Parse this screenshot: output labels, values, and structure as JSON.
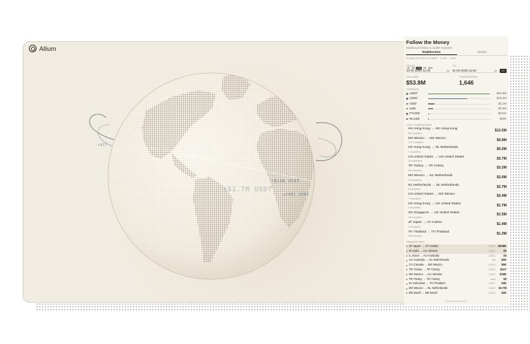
{
  "app": {
    "brand": "Allium"
  },
  "globe_labels": [
    {
      "text": "+$1T",
      "color": "#9aa3ad"
    },
    {
      "text": "+$1.7M USDT",
      "color": "#a9b1b9"
    },
    {
      "text": "+$16K USDT",
      "color": "#8f99a3"
    },
    {
      "text": "+$412 USDC",
      "color": "#8f99a3"
    }
  ],
  "panel": {
    "title": "Follow the Money",
    "subtitle": "Stablecoin flows & wallet explorer",
    "tabs": [
      {
        "label": "Stablecoins",
        "active": true
      },
      {
        "label": "Wallet",
        "active": false
      }
    ],
    "section_flows": "STABLECOIN FLOWS · LIVE · 24H",
    "ranges": [
      "1h",
      "4h",
      "24h",
      "7d",
      "30d"
    ],
    "range_selected": "24h",
    "from_label": "FROM",
    "to_label": "TO",
    "from_value": "10-02-2020 11:00",
    "to_value": "11-02-2025 11:00",
    "go_label": "GO",
    "volume_label": "VOLUME",
    "volume_value": "$53.8M",
    "transfers_label": "TRANSFERS",
    "transfers_value": "1,646",
    "tokens_label": "TOKENS",
    "tokens": [
      {
        "name": "USDT",
        "value": "$29.5M",
        "share": 0.97,
        "color": "#5f8a5a"
      },
      {
        "name": "USDC",
        "value": "$18.2M",
        "share": 0.62,
        "color": "#5a6f8c"
      },
      {
        "name": "USDI",
        "value": "$3.1M",
        "share": 0.1,
        "color": "#7a7a7a"
      },
      {
        "name": "usdc",
        "value": "$2.6M",
        "share": 0.08,
        "color": "#9a8a6a"
      },
      {
        "name": "PYUSD",
        "value": "$521K",
        "share": 0.02,
        "color": "#8c6a5a"
      },
      {
        "name": "RLUSD",
        "value": "$50K",
        "share": 0.005,
        "color": "#6a6a8c"
      }
    ],
    "corridors_label": "TOP CORRIDORS",
    "corridors": [
      {
        "route": "HK Hong Kong → HK Hong Kong",
        "count": "55 transfers",
        "amount": "$12.5M"
      },
      {
        "route": "MX Mexico → MX Mexico",
        "count": "217 transfers",
        "amount": "$5.8M"
      },
      {
        "route": "HK Hong Kong → NL Netherlands",
        "count": "1 transfers",
        "amount": "$5.0M"
      },
      {
        "route": "US United States → US United States",
        "count": "30 transfers",
        "amount": "$3.7M"
      },
      {
        "route": "TR Turkey → TR Turkey",
        "count": "50 transfers",
        "amount": "$3.2M"
      },
      {
        "route": "MX Mexico → NL Netherlands",
        "count": "11 transfers",
        "amount": "$3.0M"
      },
      {
        "route": "NL Netherlands → NL Netherlands",
        "count": "5 transfers",
        "amount": "$2.7M"
      },
      {
        "route": "US United States → MX Mexico",
        "count": "7 transfers",
        "amount": "$2.4M"
      },
      {
        "route": "HK Hong Kong → US United States",
        "count": "4 transfers",
        "amount": "$1.7M"
      },
      {
        "route": "SG Singapore → US United States",
        "count": "16 transfers",
        "amount": "$1.5M"
      },
      {
        "route": "JP Japan → AT Austria",
        "count": "2 transfers",
        "amount": "$1.4M"
      },
      {
        "route": "TH Thailand → TH Thailand",
        "count": "36 transfers",
        "amount": "$1.3M"
      }
    ],
    "transfers_section_label": "TRANSFERS",
    "transfers": [
      {
        "route": "JP Japan → AT Austria",
        "token": "USDT",
        "amount": "$548K",
        "highlight": true
      },
      {
        "route": "IN India → UA Ukraine",
        "token": "USDT",
        "amount": "$3",
        "highlight": true
      },
      {
        "route": "IL Israel → AU Australia",
        "token": "USDC",
        "amount": "$3",
        "highlight": false
      },
      {
        "route": "AU Australia → NL Netherlands",
        "token": "BM",
        "amount": "$0K",
        "highlight": false
      },
      {
        "route": "CA Canada → MX Mexico",
        "token": "USDC",
        "amount": "$6K",
        "highlight": false
      },
      {
        "route": "TR Turkey → TR Turkey",
        "token": "USDC",
        "amount": "$417",
        "highlight": false
      },
      {
        "route": "MX Mexico → UA Ukraine",
        "token": "USDT",
        "amount": "$18K",
        "highlight": false
      },
      {
        "route": "TR Turkey → TR Turkey",
        "token": "usdc",
        "amount": "$0",
        "highlight": false
      },
      {
        "route": "ID Indonesia → TH Thailand",
        "token": "USDT",
        "amount": "$3K",
        "highlight": false
      },
      {
        "route": "MX Mexico → NL Netherlands",
        "token": "USDT",
        "amount": "$2.7M",
        "highlight": false
      },
      {
        "route": "BR Brazil → BR Brazil",
        "token": "USDC",
        "amount": "$2K",
        "highlight": false
      }
    ],
    "footer": "Powered by Allium"
  }
}
